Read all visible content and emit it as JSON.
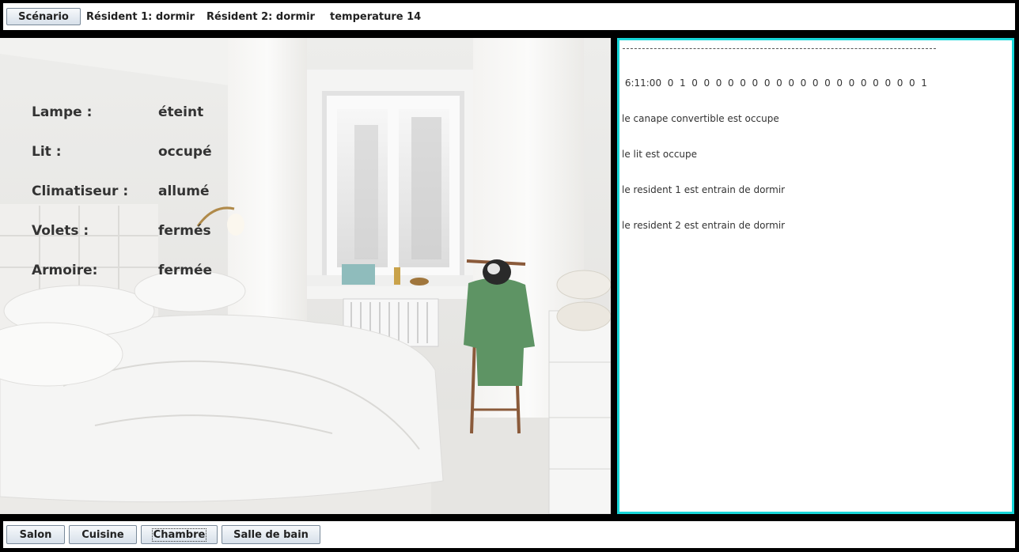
{
  "topbar": {
    "scenario_button": "Scénario",
    "resident1": "Résident 1: dormir",
    "resident2": "Résident 2: dormir",
    "temperature": "temperature 14"
  },
  "room": {
    "devices": [
      {
        "label": "Lampe :",
        "value": "éteint"
      },
      {
        "label": "Lit :",
        "value": "occupé"
      },
      {
        "label": "Climatiseur :",
        "value": "allumé"
      },
      {
        "label": "Volets :",
        "value": "fermés"
      },
      {
        "label": "Armoire:",
        "value": "fermée"
      }
    ]
  },
  "log": {
    "lines": [
      " 6:11:00  0  1  0  0  0  0  0  0  0  0  0  0  0  0  0  0  0  0  0  0  0  1",
      "le canape convertible est occupe",
      "le lit est occupe",
      "le resident 1 est entrain de dormir",
      "le resident 2 est entrain de dormir"
    ]
  },
  "nav": {
    "salon": "Salon",
    "cuisine": "Cuisine",
    "chambre": "Chambre",
    "salle_de_bain": "Salle de bain"
  },
  "colors": {
    "log_border": "#17d6d9",
    "frame": "#000000"
  }
}
